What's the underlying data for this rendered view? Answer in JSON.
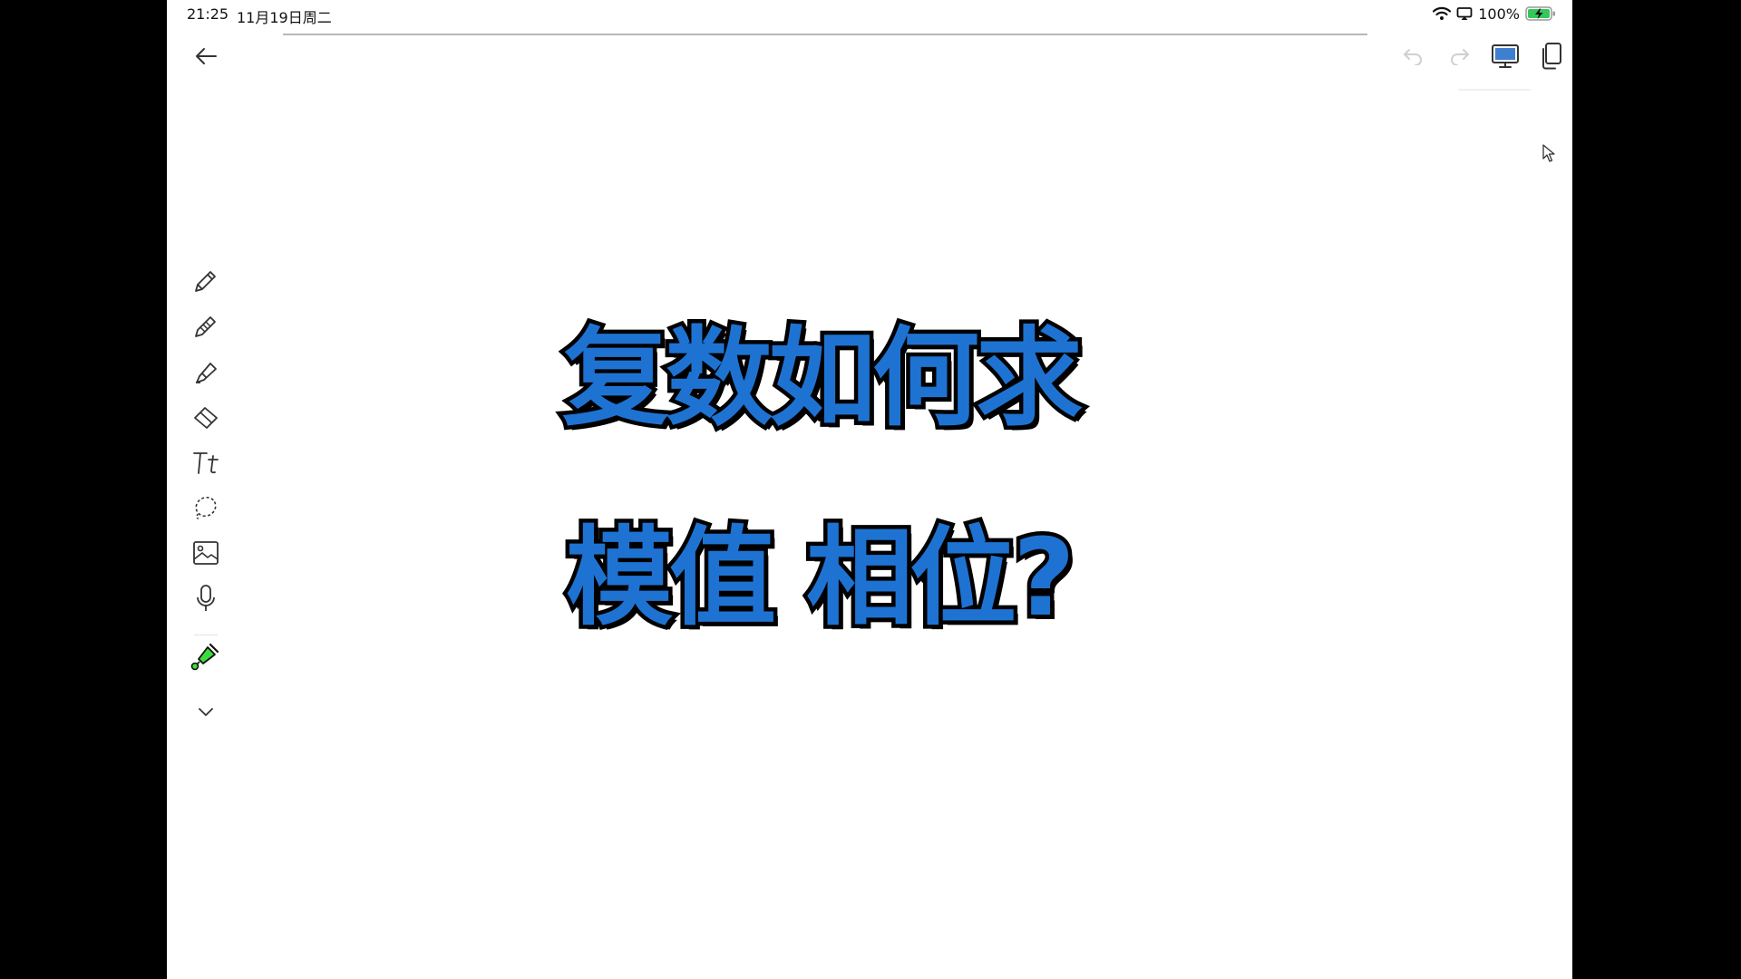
{
  "status_bar": {
    "time": "21:25",
    "date": "11月19日周二",
    "battery_percent": "100%",
    "battery_level": 1.0,
    "battery_color": "#34c759"
  },
  "header": {
    "back_icon": "arrow-left-icon",
    "undo_icon": "undo-icon",
    "redo_icon": "redo-icon",
    "present_icon": "monitor-icon",
    "pages_icon": "pages-icon"
  },
  "toolbar": {
    "tools": [
      {
        "name": "pen",
        "icon": "pen-icon"
      },
      {
        "name": "pencil",
        "icon": "pencil-icon"
      },
      {
        "name": "highlighter",
        "icon": "highlighter-icon"
      },
      {
        "name": "eraser",
        "icon": "eraser-icon"
      },
      {
        "name": "text",
        "icon": "text-icon"
      },
      {
        "name": "lasso",
        "icon": "lasso-icon"
      },
      {
        "name": "image",
        "icon": "image-icon"
      },
      {
        "name": "microphone",
        "icon": "microphone-icon"
      },
      {
        "name": "laser-pointer",
        "icon": "laser-pointer-icon",
        "color": "#3ddc3d"
      },
      {
        "name": "more",
        "icon": "chevron-down-icon"
      }
    ]
  },
  "canvas": {
    "line1": "复数如何求",
    "line2": "模值 相位?",
    "text_color": "#1e73d2",
    "outline_color": "#000000"
  }
}
